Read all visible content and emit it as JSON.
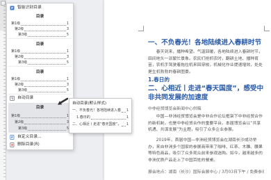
{
  "menu": {
    "smart_toc": "智能识别目录",
    "cards": [
      {
        "title": "目录",
        "levels": [
          {
            "label": "第1级",
            "page": "1"
          },
          {
            "label": "第2级",
            "page": "3"
          },
          {
            "label": "第3级",
            "page": "5"
          }
        ]
      },
      {
        "title": "目录",
        "levels": [
          {
            "label": "第1级",
            "page": "1"
          },
          {
            "label": "第2级",
            "page": "3"
          },
          {
            "label": "第3级",
            "page": "5"
          }
        ]
      },
      {
        "title": "目录",
        "levels": [
          {
            "label": "第1级",
            "page": "1"
          },
          {
            "label": "第2级",
            "page": "3"
          },
          {
            "label": "第3级",
            "page": "5"
          }
        ]
      },
      {
        "title": "目录",
        "levels": [
          {
            "label": "第1级",
            "page": "1"
          },
          {
            "label": "第2级",
            "page": "3"
          },
          {
            "label": "第3级",
            "page": "5"
          }
        ]
      }
    ],
    "auto_toc": "自动目录",
    "custom_toc": "自定义目录...",
    "delete_toc": "删除目录(R)"
  },
  "preview": {
    "title": "自动目录(默认样式)",
    "entries": [
      {
        "text": "一、不负春光！各地陆续进入春耕时节",
        "page": "1"
      },
      {
        "text": "1.春日的",
        "page": "1"
      },
      {
        "text": "二、心相近丨走进“春天国度”，感受中非共同发展的加速度",
        "page": "1"
      }
    ]
  },
  "document": {
    "heading1": "一、不负春光！各地陆续进入春耕时节",
    "para1": "春天到来，播种希望。气温回暖，各地陆续进入春耕时节，田间地头一派繁忙景象。农民们抢抓农时，翻耕土地、播种育苗，农机手驾驶着拖拉机来回穿梭，机械化作业提速增效，处处是生机勃勃的春耕图景。",
    "subheading": "1.春日的",
    "heading2": "二、心相近丨走进“春天国度”，感受中非共同发展的加速度",
    "caption": "中非经贸博览会新闻中心供稿",
    "para2": "中国—非洲经贸博览会是中非合作论坛框架下中非经贸合作的新机制，也是中非经贸合作的重要平台。本届博览会以“共享机遇、共谋发展”为主题，吸引了众多企业参展。",
    "para3": "2019年，首届中国—非洲经贸博览会在湖南长沙成功举办，来自非洲多个国家的参展商带来了咖啡、红茶、木雕、腰果等特色商品，吸引了众多观众前来参观选购。如今，越来越多的非洲优质产品走上了中国百姓的餐桌。",
    "para4": "展会地点：湖南（长沙）国际会展中心 / 3月03日下午 / 免费参观"
  },
  "icons": {
    "smart_toc": "smart-toc-icon",
    "auto_toc": "auto-toc-icon",
    "custom_toc": "custom-toc-icon",
    "delete_toc": "delete-toc-icon",
    "pointer": "pointer-arrow-icon"
  },
  "colors": {
    "heading": "#2a5ba8",
    "hover_bg": "#e3e5e9",
    "menu_bg": "#ffffff",
    "canvas": "#eceef1",
    "pointer": "#333333"
  }
}
